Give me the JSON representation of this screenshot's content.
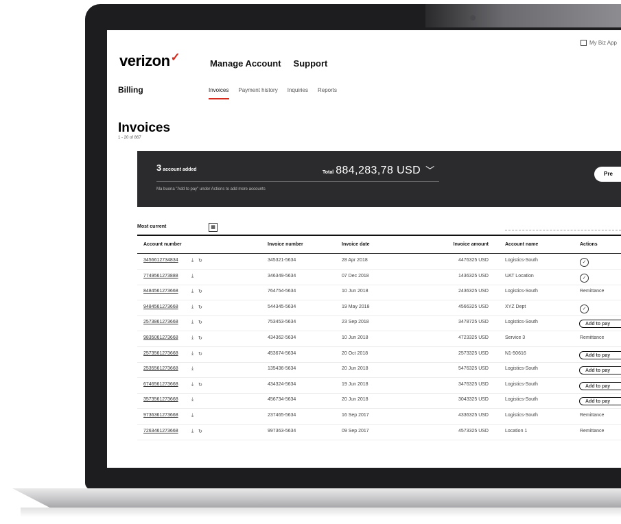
{
  "header": {
    "top_right_link": "My Biz App",
    "logo": "verizon",
    "nav": [
      "Manage Account",
      "Support"
    ],
    "section": "Billing",
    "subnav": [
      "Invoices",
      "Payment history",
      "Inquiries",
      "Reports"
    ]
  },
  "page": {
    "title": "Invoices",
    "count": "1 - 20 of 867"
  },
  "summary": {
    "accounts_count": "3",
    "accounts_label": "account added",
    "total_label": "Total",
    "total_amount": "884,283,78 USD",
    "hint": "Ma buona \"Add to pay\" under Actions to add more accounts",
    "pay_button": "Pre"
  },
  "sort": {
    "label": "Most current"
  },
  "table": {
    "headers": [
      "Account number",
      "Invoice number",
      "Invoice date",
      "Invoice amount",
      "Account name",
      "Actions"
    ],
    "rows": [
      {
        "account": "3456612734834",
        "invoice": "345321-5634",
        "date": "28 Apr 2018",
        "amount": "4476325 USD",
        "name": "Logistics-South",
        "action_type": "check",
        "action": ""
      },
      {
        "account": "7749561273888",
        "invoice": "346349-5634",
        "date": "07 Dec 2018",
        "amount": "1436325 USD",
        "name": "UAT Location",
        "action_type": "check",
        "action": ""
      },
      {
        "account": "8484561273668",
        "invoice": "764754-5634",
        "date": "10 Jun 2018",
        "amount": "2436325 USD",
        "name": "Logistics-South",
        "action_type": "text",
        "action": "Remittance"
      },
      {
        "account": "9484561273668",
        "invoice": "544345-5634",
        "date": "19 May 2018",
        "amount": "4566325 USD",
        "name": "XYZ Dept",
        "action_type": "check",
        "action": ""
      },
      {
        "account": "2573861273668",
        "invoice": "753453-5634",
        "date": "23 Sep 2018",
        "amount": "3478725 USD",
        "name": "Logistics-South",
        "action_type": "pill",
        "action": "Add to pay"
      },
      {
        "account": "9835061273668",
        "invoice": "434362-5634",
        "date": "10 Jun 2018",
        "amount": "4723325 USD",
        "name": "Service 3",
        "action_type": "text",
        "action": "Remittance"
      },
      {
        "account": "2573561273668",
        "invoice": "453674-5634",
        "date": "20 Oct 2018",
        "amount": "2573325 USD",
        "name": "N1-50616",
        "action_type": "pill",
        "action": "Add to pay"
      },
      {
        "account": "2535561273668",
        "invoice": "135436-5634",
        "date": "20 Jun 2018",
        "amount": "5476325 USD",
        "name": "Logistics-South",
        "action_type": "pill",
        "action": "Add to pay"
      },
      {
        "account": "6746561273668",
        "invoice": "434324-5634",
        "date": "19 Jun 2018",
        "amount": "3476325 USD",
        "name": "Logistics-South",
        "action_type": "pill",
        "action": "Add to pay"
      },
      {
        "account": "3573561273668",
        "invoice": "456734-5634",
        "date": "20 Jun 2018",
        "amount": "3043325 USD",
        "name": "Logistics-South",
        "action_type": "pill",
        "action": "Add to pay"
      },
      {
        "account": "9736361273668",
        "invoice": "237465-5634",
        "date": "16 Sep 2017",
        "amount": "4336325 USD",
        "name": "Logistics-South",
        "action_type": "text",
        "action": "Remittance"
      },
      {
        "account": "7263461273668",
        "invoice": "997363-5634",
        "date": "09 Sep 2017",
        "amount": "4573325 USD",
        "name": "Location 1",
        "action_type": "text",
        "action": "Remittance"
      }
    ]
  },
  "icons": {
    "download": "download-icon",
    "refresh": "refresh-icon",
    "calendar": "calendar-icon",
    "chevron": "chevron-down-icon",
    "check": "check-circle-icon"
  },
  "colors": {
    "brand_red": "#d52b1e",
    "panel_dark": "#2b2b2d"
  }
}
